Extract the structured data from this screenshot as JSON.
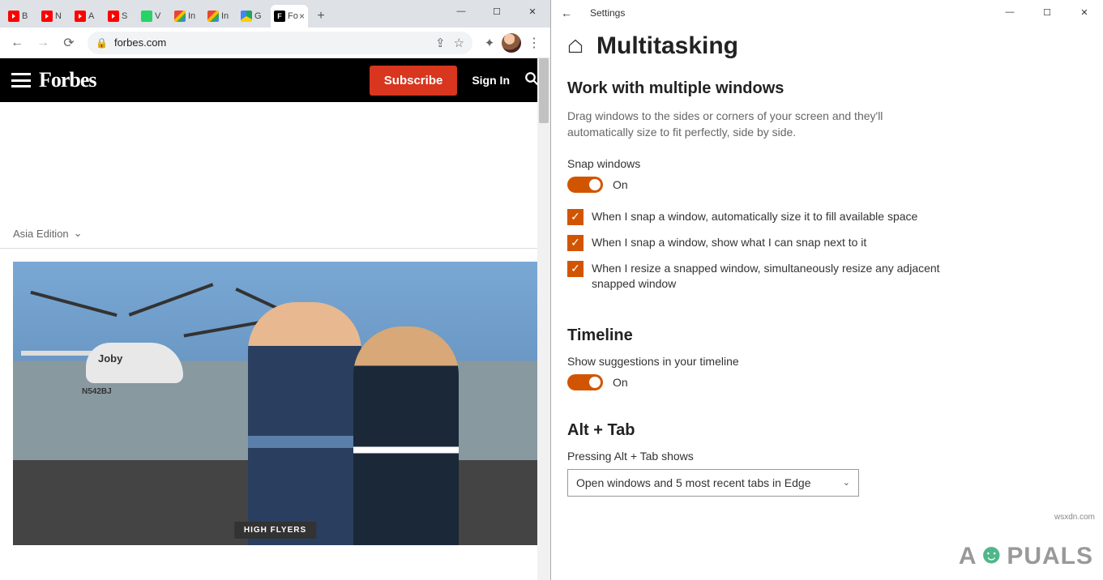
{
  "chrome": {
    "tabs": [
      {
        "label": "B"
      },
      {
        "label": "N"
      },
      {
        "label": "A"
      },
      {
        "label": "S"
      },
      {
        "label": "V"
      },
      {
        "label": "In"
      },
      {
        "label": "In"
      },
      {
        "label": "G"
      },
      {
        "label": "Fo"
      }
    ],
    "omnibox": {
      "url": "forbes.com"
    },
    "win": {
      "min": "—",
      "max": "☐",
      "close": "✕"
    }
  },
  "forbes": {
    "logo": "Forbes",
    "subscribe": "Subscribe",
    "signin": "Sign In",
    "edition": "Asia Edition",
    "tag": "HIGH FLYERS",
    "heli_reg": "N542BJ"
  },
  "settings": {
    "back": "←",
    "app_title": "Settings",
    "page_title": "Multitasking",
    "section1": {
      "heading": "Work with multiple windows",
      "desc": "Drag windows to the sides or corners of your screen and they'll automatically size to fit perfectly, side by side.",
      "snap_label": "Snap windows",
      "snap_state": "On",
      "check1": "When I snap a window, automatically size it to fill available space",
      "check2": "When I snap a window, show what I can snap next to it",
      "check3": "When I resize a snapped window, simultaneously resize any adjacent snapped window"
    },
    "section2": {
      "heading": "Timeline",
      "label": "Show suggestions in your timeline",
      "state": "On"
    },
    "section3": {
      "heading": "Alt + Tab",
      "label": "Pressing Alt + Tab shows",
      "selected": "Open windows and 5 most recent tabs in Edge"
    },
    "win": {
      "min": "—",
      "max": "☐",
      "close": "✕"
    }
  },
  "watermark": {
    "text_a": "A",
    "text_b": "PUALS",
    "url": "wsxdn.com"
  }
}
